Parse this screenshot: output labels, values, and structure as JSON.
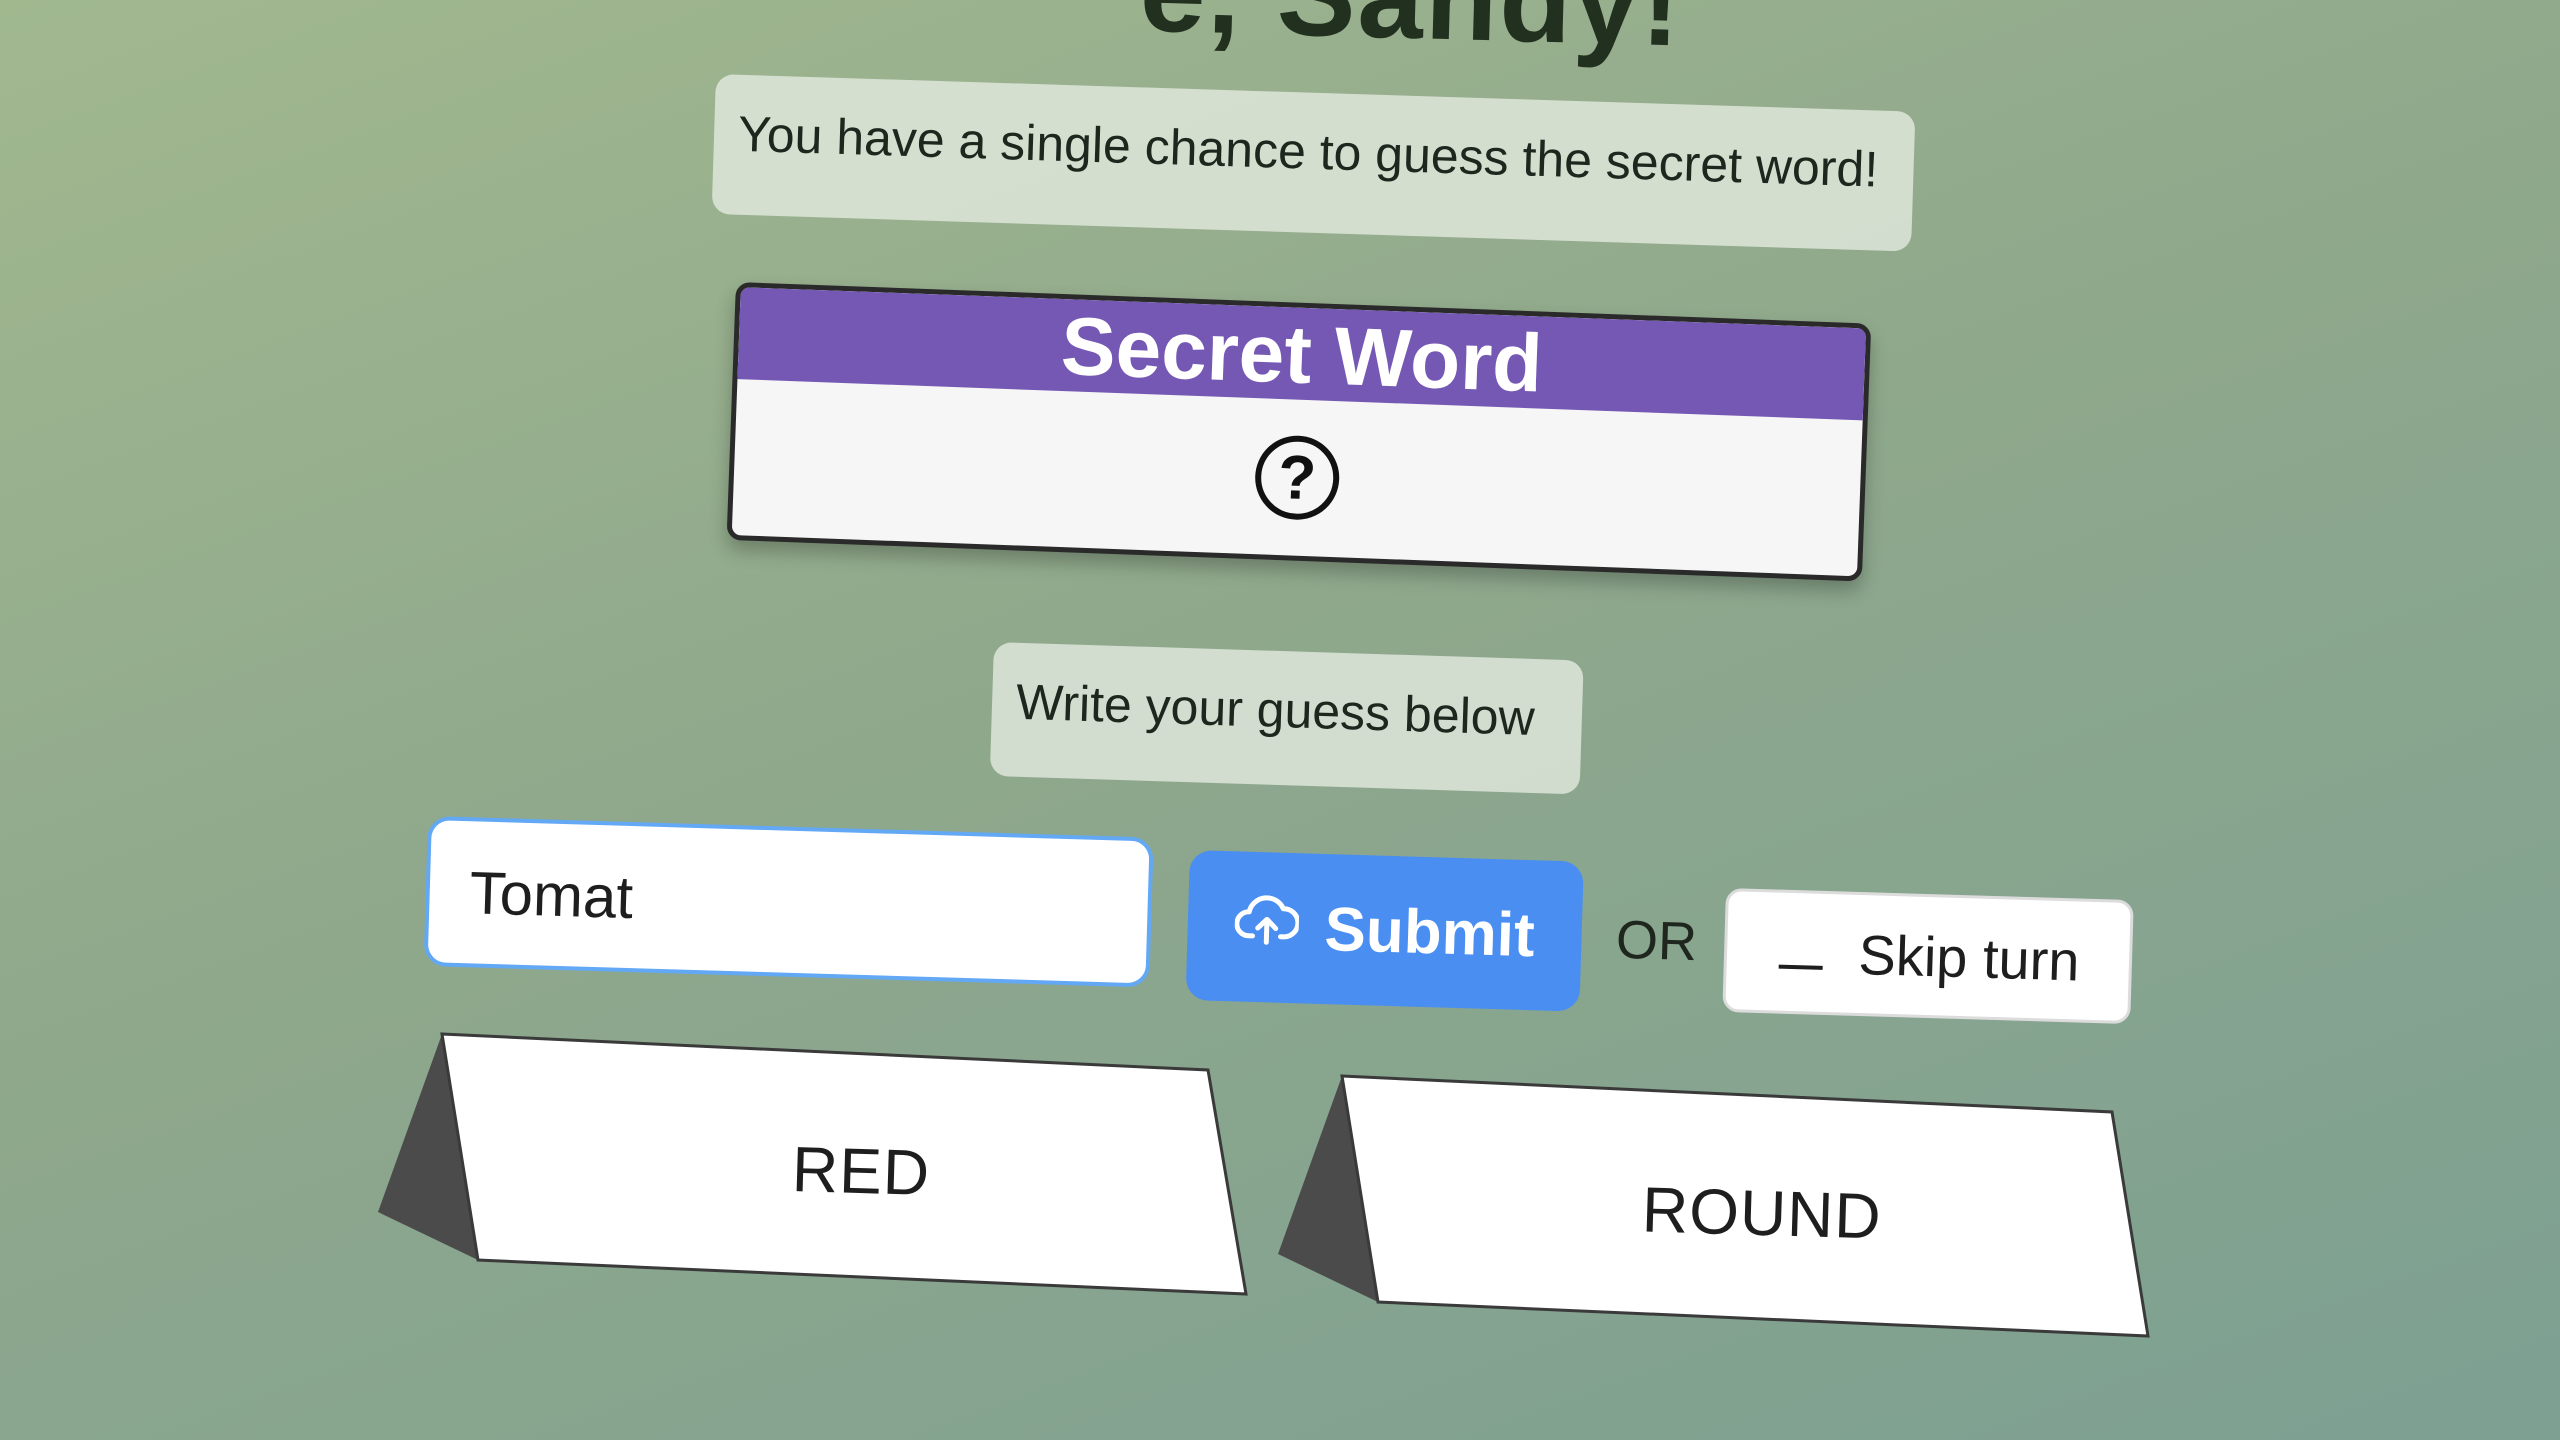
{
  "header": {
    "title_fragment": "e, Sandy!"
  },
  "intro": {
    "text": "You have a single chance to guess the secret word!"
  },
  "secret_card": {
    "title": "Secret Word",
    "hidden_symbol": "?"
  },
  "guess_prompt": {
    "text": "Write your guess below"
  },
  "guess_input": {
    "value": "Tomat",
    "placeholder": ""
  },
  "actions": {
    "submit_label": "Submit",
    "or_label": "OR",
    "skip_label": "Skip turn"
  },
  "clues": [
    {
      "label": "RED"
    },
    {
      "label": "ROUND"
    }
  ],
  "colors": {
    "card_header": "#7458b3",
    "submit_button": "#4a8ef2",
    "input_border": "#63a8f5"
  }
}
